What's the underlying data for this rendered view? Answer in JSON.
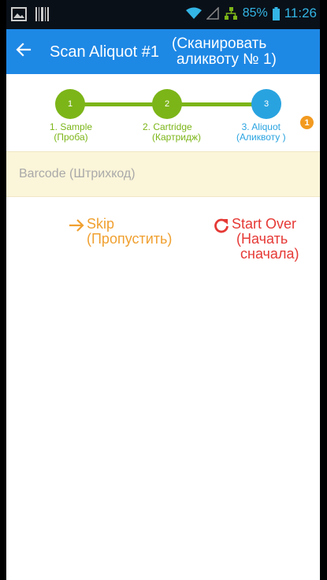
{
  "status_bar": {
    "battery": "85%",
    "time": "11:26"
  },
  "app_bar": {
    "title": "Scan Aliquot #1",
    "title_ru_line1": "(Сканировать",
    "title_ru_line2": "аликвоту № 1)"
  },
  "stepper": {
    "steps": [
      {
        "number": "1",
        "label_line1": "1. Sample",
        "label_line2": "(Проба)",
        "color": "#7cb518"
      },
      {
        "number": "2",
        "label_line1": "2. Cartridge",
        "label_line2": "(Картридж)",
        "color": "#7cb518"
      },
      {
        "number": "3",
        "label_line1": "3. Aliquot",
        "label_line2": "(Аликвоту )",
        "color": "#29a3e0"
      }
    ],
    "badge": "1"
  },
  "barcode": {
    "placeholder": "Barcode (Штрихкод)"
  },
  "actions": {
    "skip_line1": "Skip",
    "skip_line2": "(Пропустить)",
    "start_over_line1": "Start Over",
    "start_over_line2": "(Начать",
    "start_over_line3": "сначала)"
  },
  "colors": {
    "app_bar": "#1e88e5",
    "step_done": "#7cb518",
    "step_current": "#29a3e0",
    "skip": "#f0a030",
    "start_over": "#e53935",
    "barcode_bg": "#fbf5d9"
  }
}
